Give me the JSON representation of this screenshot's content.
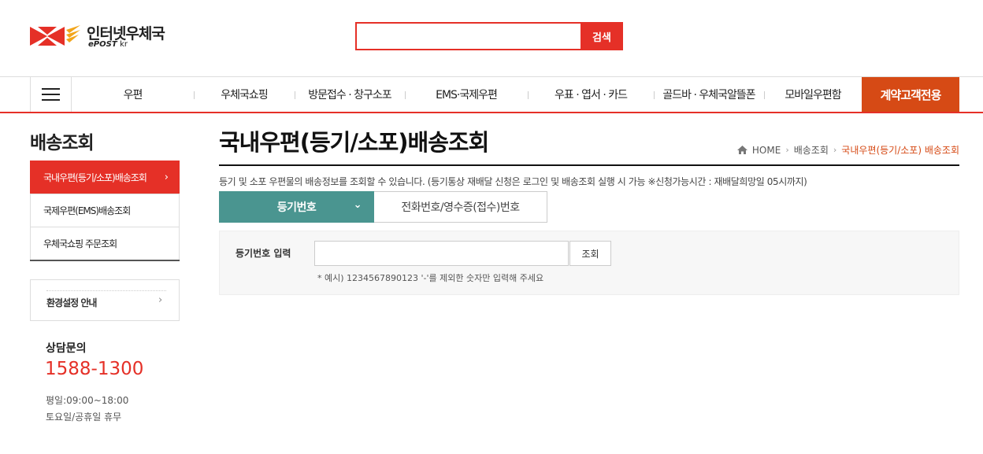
{
  "header": {
    "logo_text": "인터넷우체국",
    "logo_sub_main": "ePOST",
    "logo_sub_kr": "kr",
    "search_placeholder": "",
    "search_value": "",
    "search_button": "검색"
  },
  "gnb": {
    "items": [
      {
        "label": "우편"
      },
      {
        "label": "우체국쇼핑"
      },
      {
        "label": "방문접수 · 창구소포"
      },
      {
        "label": "EMS·국제우편"
      },
      {
        "label": "우표 · 엽서 · 카드"
      },
      {
        "label": "골드바 · 우체국알뜰폰"
      },
      {
        "label": "모바일우편함"
      }
    ],
    "special": "계약고객전용"
  },
  "sidebar": {
    "title": "배송조회",
    "items": [
      {
        "label": "국내우편(등기/소포)배송조회",
        "active": true
      },
      {
        "label": "국제우편(EMS)배송조회",
        "active": false
      },
      {
        "label": "우체국쇼핑 주문조회",
        "active": false
      }
    ],
    "env_label": "환경설정 안내",
    "cs_title": "상담문의",
    "cs_phone": "1588-1300",
    "cs_hours_weekday": "평일:09:00~18:00",
    "cs_hours_weekend": "토요일/공휴일 휴무"
  },
  "content": {
    "title": "국내우편(등기/소포)배송조회",
    "breadcrumb": {
      "home": "HOME",
      "level1": "배송조회",
      "current": "국내우편(등기/소포) 배송조회"
    },
    "description": "등기 및 소포 우편물의 배송정보를 조회할 수 있습니다. (등기통상 재배달 신청은 로그인 및 배송조회 실행 시 가능 ※신청가능시간 : 재배달희망일 05시까지)",
    "tabs": [
      {
        "label": "등기번호",
        "active": true
      },
      {
        "label": "전화번호/영수증(접수)번호",
        "active": false
      }
    ],
    "input_label": "등기번호 입력",
    "input_value": "",
    "input_placeholder": "",
    "search_button": "조회",
    "hint": "* 예시) 1234567890123 '-'를 제외한 숫자만 입력해 주세요"
  },
  "colors": {
    "brand_red": "#e53027",
    "special_orange": "#d64a15",
    "tab_teal": "#4a9590"
  },
  "icons": {
    "menu": "hamburger-icon",
    "home": "home-icon",
    "chevron_right": "chevron-right-icon",
    "chevron_down": "chevron-down-icon"
  }
}
